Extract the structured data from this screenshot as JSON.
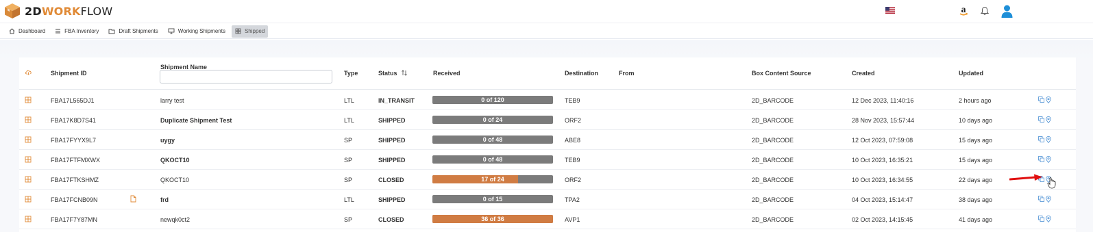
{
  "header": {
    "logo_a": "2D",
    "logo_b": "WORK",
    "logo_c": "FLOW"
  },
  "nav": [
    {
      "label": "Dashboard",
      "icon": "home-icon"
    },
    {
      "label": "FBA Inventory",
      "icon": "list-icon"
    },
    {
      "label": "Draft Shipments",
      "icon": "folder-icon"
    },
    {
      "label": "Working Shipments",
      "icon": "monitor-icon"
    },
    {
      "label": "Shipped",
      "icon": "grid-icon",
      "active": true
    }
  ],
  "table": {
    "headers": {
      "shipment_id": "Shipment ID",
      "shipment_name": "Shipment Name",
      "type": "Type",
      "status": "Status",
      "received": "Received",
      "destination": "Destination",
      "from": "From",
      "box_source": "Box Content Source",
      "created": "Created",
      "updated": "Updated"
    },
    "name_filter_value": "",
    "rows": [
      {
        "id": "FBA17L565DJ1",
        "name": "larry test",
        "name_bold": false,
        "doc": false,
        "type": "LTL",
        "status": "IN_TRANSIT",
        "received_text": "0 of 120",
        "received": 0,
        "total": 120,
        "dest": "TEB9",
        "from": "",
        "source": "2D_BARCODE",
        "created": "12 Dec 2023, 11:40:16",
        "updated": "2 hours ago"
      },
      {
        "id": "FBA17K8D7S41",
        "name": "Duplicate Shipment Test",
        "name_bold": true,
        "doc": false,
        "type": "LTL",
        "status": "SHIPPED",
        "received_text": "0 of 24",
        "received": 0,
        "total": 24,
        "dest": "ORF2",
        "from": "",
        "source": "2D_BARCODE",
        "created": "28 Nov 2023, 15:57:44",
        "updated": "10 days ago"
      },
      {
        "id": "FBA17FYYX9L7",
        "name": "uygy",
        "name_bold": true,
        "doc": false,
        "type": "SP",
        "status": "SHIPPED",
        "received_text": "0 of 48",
        "received": 0,
        "total": 48,
        "dest": "ABE8",
        "from": "",
        "source": "2D_BARCODE",
        "created": "12 Oct 2023, 07:59:08",
        "updated": "15 days ago"
      },
      {
        "id": "FBA17FTFMXWX",
        "name": "QKOCT10",
        "name_bold": true,
        "doc": false,
        "type": "SP",
        "status": "SHIPPED",
        "received_text": "0 of 48",
        "received": 0,
        "total": 48,
        "dest": "TEB9",
        "from": "",
        "source": "2D_BARCODE",
        "created": "10 Oct 2023, 16:35:21",
        "updated": "15 days ago"
      },
      {
        "id": "FBA17FTKSHMZ",
        "name": "QKOCT10",
        "name_bold": false,
        "doc": false,
        "type": "SP",
        "status": "CLOSED",
        "received_text": "17 of 24",
        "received": 17,
        "total": 24,
        "dest": "ORF2",
        "from": "",
        "source": "2D_BARCODE",
        "created": "10 Oct 2023, 16:34:55",
        "updated": "22 days ago"
      },
      {
        "id": "FBA17FCNB09N",
        "name": "frd",
        "name_bold": true,
        "doc": true,
        "type": "LTL",
        "status": "SHIPPED",
        "received_text": "0 of 15",
        "received": 0,
        "total": 15,
        "dest": "TPA2",
        "from": "",
        "source": "2D_BARCODE",
        "created": "04 Oct 2023, 15:14:47",
        "updated": "38 days ago"
      },
      {
        "id": "FBA17F7Y87MN",
        "name": "newqk0ct2",
        "name_bold": false,
        "doc": false,
        "type": "SP",
        "status": "CLOSED",
        "received_text": "36 of 36",
        "received": 36,
        "total": 36,
        "dest": "AVP1",
        "from": "",
        "source": "2D_BARCODE",
        "created": "02 Oct 2023, 14:15:45",
        "updated": "41 days ago"
      }
    ]
  },
  "colors": {
    "accent": "#e08a36",
    "progress_fill": "#d07c43",
    "progress_empty": "#7b7b7b",
    "action_icon": "#4a8fd4",
    "annotation_arrow": "#e01010"
  }
}
